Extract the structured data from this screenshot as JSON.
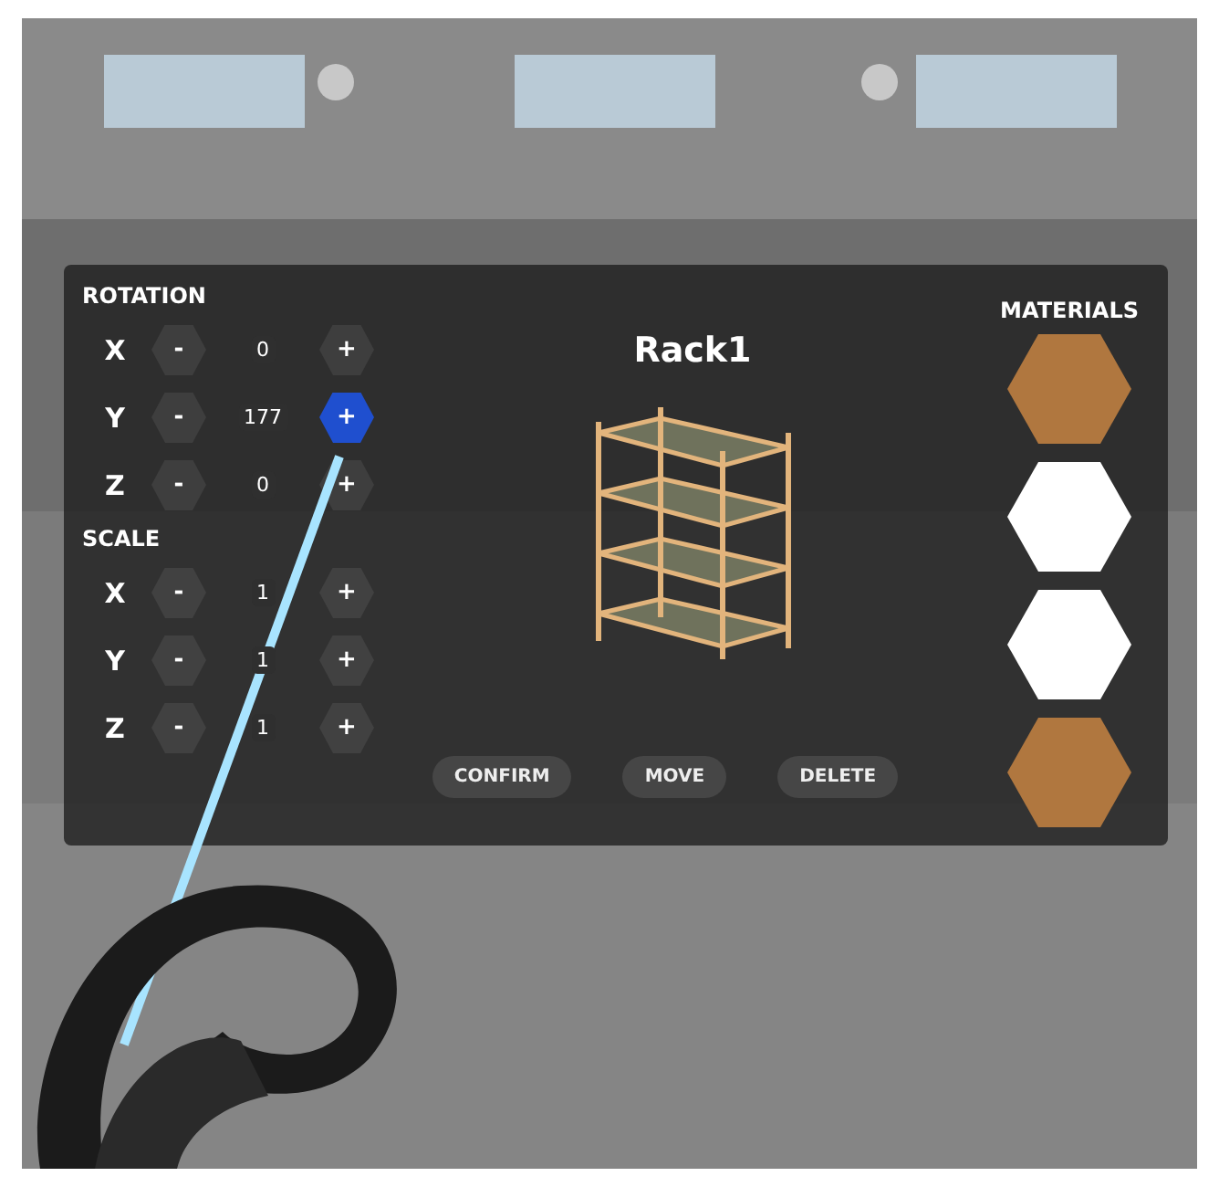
{
  "rotation": {
    "title": "ROTATION",
    "rows": [
      {
        "axis": "X",
        "minus": "-",
        "value": "0",
        "plus": "+",
        "highlighted": false
      },
      {
        "axis": "Y",
        "minus": "-",
        "value": "177",
        "plus": "+",
        "highlighted": true
      },
      {
        "axis": "Z",
        "minus": "-",
        "value": "0",
        "plus": "+",
        "highlighted": false
      }
    ]
  },
  "scale": {
    "title": "SCALE",
    "rows": [
      {
        "axis": "X",
        "minus": "-",
        "value": "1",
        "plus": "+",
        "highlighted": false
      },
      {
        "axis": "Y",
        "minus": "-",
        "value": "1",
        "plus": "+",
        "highlighted": false
      },
      {
        "axis": "Z",
        "minus": "-",
        "value": "1",
        "plus": "+",
        "highlighted": false
      }
    ]
  },
  "object": {
    "name": "Rack1"
  },
  "actions": [
    "CONFIRM",
    "MOVE",
    "DELETE"
  ],
  "materials": {
    "title": "MATERIALS",
    "swatches": [
      {
        "color": "#b0773f"
      },
      {
        "color": "#ffffff"
      },
      {
        "color": "#ffffff"
      },
      {
        "color": "#b0773f"
      }
    ]
  }
}
